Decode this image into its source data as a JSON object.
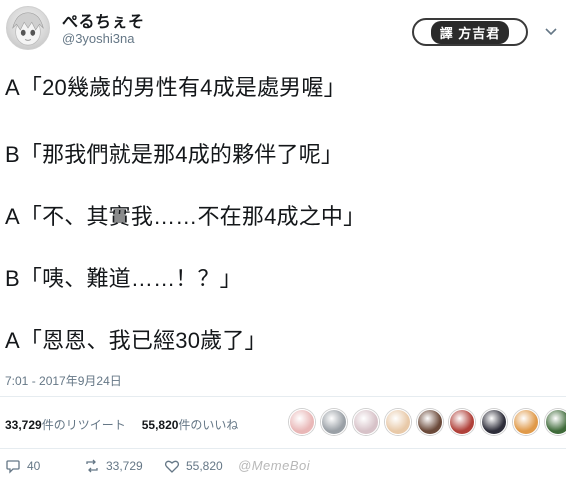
{
  "header": {
    "display_name": "ぺるちぇそ",
    "handle": "@3yoshi3na",
    "follow_button_label": "譯 方吉君"
  },
  "tweet": {
    "lines": [
      "A「20幾歲的男性有4成是處男喔」",
      "B「那我們就是那4成的夥伴了呢」",
      "A「不、其實我……不在那4成之中」",
      "B「咦、難道……！？」",
      "A「恩恩、我已經30歲了」"
    ],
    "timestamp": "7:01 - 2017年9月24日"
  },
  "stats": {
    "retweet_count": "33,729",
    "retweet_label": "件のリツイート",
    "like_count": "55,820",
    "like_label": "件のいいね"
  },
  "likers": [
    {
      "icon": "avatar-1",
      "color": "#e9b7b7"
    },
    {
      "icon": "avatar-2",
      "color": "#9aa0a6"
    },
    {
      "icon": "avatar-3",
      "color": "#d7c2c8"
    },
    {
      "icon": "avatar-4",
      "color": "#e8c9a8"
    },
    {
      "icon": "avatar-5",
      "color": "#6b4a3a"
    },
    {
      "icon": "avatar-6",
      "color": "#b0413a"
    },
    {
      "icon": "avatar-7",
      "color": "#2e2e3a"
    },
    {
      "icon": "avatar-8",
      "color": "#e09a4a"
    },
    {
      "icon": "avatar-9",
      "color": "#3f6b3a"
    }
  ],
  "actions": {
    "reply_count": "40",
    "retweet_count": "33,729",
    "like_count": "55,820"
  },
  "watermark": "@MemeBoi",
  "colors": {
    "text": "#14171a",
    "muted": "#657786",
    "divider": "#e6ecf0"
  }
}
